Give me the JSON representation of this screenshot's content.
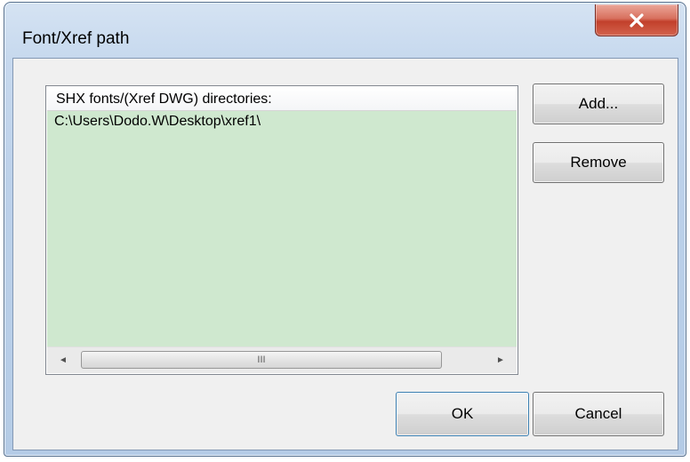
{
  "window": {
    "title": "Font/Xref path",
    "close_icon": "close-icon"
  },
  "list": {
    "header": "SHX fonts/(Xref DWG) directories:",
    "items": [
      "C:\\Users\\Dodo.W\\Desktop\\xref1\\"
    ],
    "background_color": "#cfe8cf",
    "scrollbar": {
      "left_arrow": "◄",
      "right_arrow": "►",
      "grip": "III"
    }
  },
  "buttons": {
    "add": "Add...",
    "remove": "Remove",
    "ok": "OK",
    "cancel": "Cancel"
  }
}
